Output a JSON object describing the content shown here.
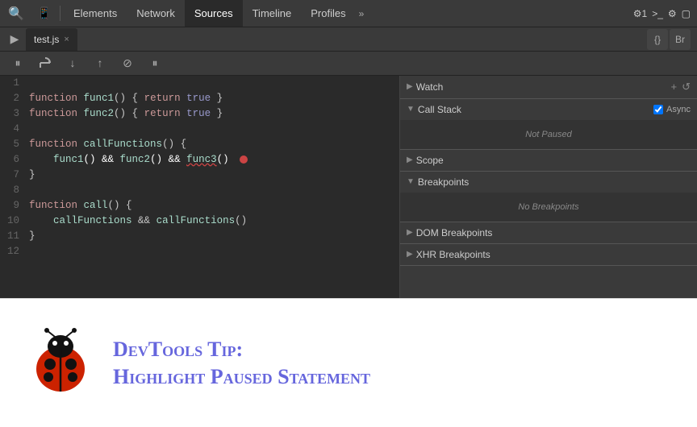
{
  "toolbar": {
    "tabs": [
      {
        "label": "Elements",
        "active": false
      },
      {
        "label": "Network",
        "active": false
      },
      {
        "label": "Sources",
        "active": true
      },
      {
        "label": "Timeline",
        "active": false
      },
      {
        "label": "Profiles",
        "active": false
      }
    ],
    "more_label": "»",
    "worker_count": "1",
    "console_icon": ">_",
    "gear_icon": "⚙",
    "screen_icon": "▢"
  },
  "sources_bar": {
    "play_icon": "▶",
    "file_name": "test.js",
    "close_icon": "×",
    "pretty_print": "{}",
    "format_icon": "Br"
  },
  "debug_toolbar": {
    "pause_icon": "⏸",
    "step_over": "↷",
    "step_into": "↓",
    "step_out": "↑",
    "deactivate": "⊘",
    "pause_exceptions": "⏸"
  },
  "code": {
    "lines": [
      {
        "num": 1,
        "content": ""
      },
      {
        "num": 2,
        "content": "function func1() { return true }"
      },
      {
        "num": 3,
        "content": "function func2() { return true }"
      },
      {
        "num": 4,
        "content": ""
      },
      {
        "num": 5,
        "content": "function callFunctions() {"
      },
      {
        "num": 6,
        "content": "    func1() && func2() && func3()",
        "error": true
      },
      {
        "num": 7,
        "content": "}"
      },
      {
        "num": 8,
        "content": ""
      },
      {
        "num": 9,
        "content": "function call() {"
      },
      {
        "num": 10,
        "content": "    callFunctions && callFunctions()"
      },
      {
        "num": 11,
        "content": "}"
      },
      {
        "num": 12,
        "content": ""
      }
    ]
  },
  "right_panel": {
    "watch": {
      "label": "Watch",
      "add_icon": "+",
      "refresh_icon": "↺",
      "collapsed": false
    },
    "call_stack": {
      "label": "Call Stack",
      "collapsed": false,
      "async_label": "Async",
      "status": "Not Paused"
    },
    "scope": {
      "label": "Scope",
      "collapsed": true
    },
    "breakpoints": {
      "label": "Breakpoints",
      "collapsed": false,
      "status": "No Breakpoints"
    },
    "dom_breakpoints": {
      "label": "DOM Breakpoints",
      "collapsed": true
    },
    "xhr_breakpoints": {
      "label": "XHR Breakpoints",
      "collapsed": true
    }
  },
  "tip": {
    "title_line1": "DevTools Tip:",
    "title_line2": "Highlight Paused Statement"
  }
}
